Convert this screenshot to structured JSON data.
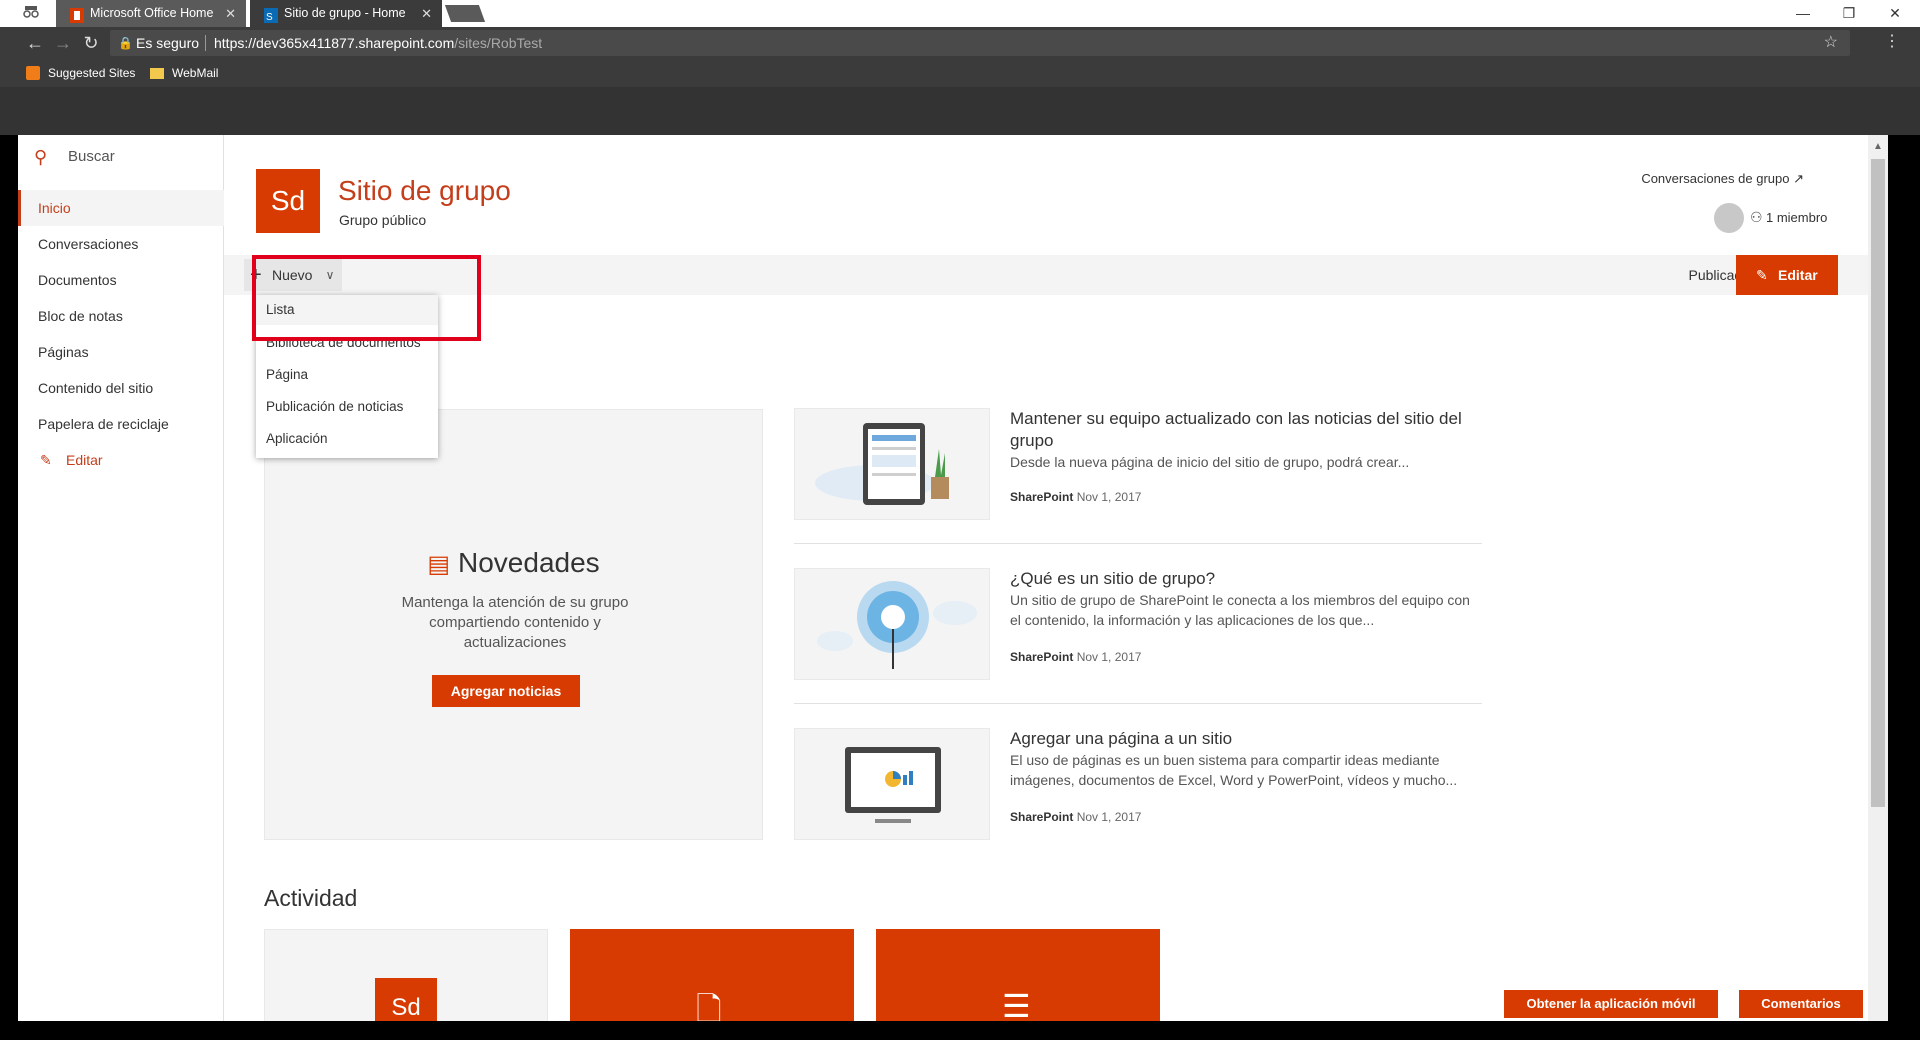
{
  "browser": {
    "tabs": [
      {
        "title": "Microsoft Office Home"
      },
      {
        "title": "Sitio de grupo - Home"
      }
    ],
    "secure_label": "Es seguro",
    "url_host": "https://dev365x411877.sharepoint.com",
    "url_path": "/sites/RobTest",
    "bookmarks": [
      "Suggested Sites",
      "WebMail"
    ]
  },
  "leftnav": {
    "search_placeholder": "Buscar",
    "items": [
      "Inicio",
      "Conversaciones",
      "Documentos",
      "Bloc de notas",
      "Páginas",
      "Contenido del sitio",
      "Papelera de reciclaje"
    ],
    "edit_label": "Editar"
  },
  "site": {
    "logo_initials": "Sd",
    "title": "Sitio de grupo",
    "subtitle": "Grupo público",
    "conversations_link": "Conversaciones de grupo",
    "members": "1 miembro"
  },
  "commandbar": {
    "new_label": "Nuevo",
    "published": "Publicado",
    "edit": "Editar"
  },
  "new_menu": {
    "items": [
      "Lista",
      "Biblioteca de documentos",
      "Página",
      "Publicación de noticias",
      "Aplicación"
    ]
  },
  "news": {
    "title": "Novedades",
    "description": "Mantenga la atención de su grupo compartiendo contenido y actualizaciones",
    "button": "Agregar noticias"
  },
  "articles": [
    {
      "title": "Mantener su equipo actualizado con las noticias del sitio del grupo",
      "description": "Desde la nueva página de inicio del sitio de grupo, podrá crear...",
      "author": "SharePoint",
      "date": "Nov 1, 2017"
    },
    {
      "title": "¿Qué es un sitio de grupo?",
      "description": "Un sitio de grupo de SharePoint le conecta a los miembros del equipo con el contenido, la información y las aplicaciones de los que...",
      "author": "SharePoint",
      "date": "Nov 1, 2017"
    },
    {
      "title": "Agregar una página a un sitio",
      "description": "El uso de páginas es un buen sistema para compartir ideas mediante imágenes, documentos de Excel, Word y PowerPoint, vídeos y mucho...",
      "author": "SharePoint",
      "date": "Nov 1, 2017"
    }
  ],
  "activity": {
    "title": "Actividad",
    "card_initials": "Sd"
  },
  "footer": {
    "mobile_app": "Obtener la aplicación móvil",
    "feedback": "Comentarios"
  },
  "colors": {
    "accent": "#d83b01",
    "highlight_box": "#e0001b"
  }
}
